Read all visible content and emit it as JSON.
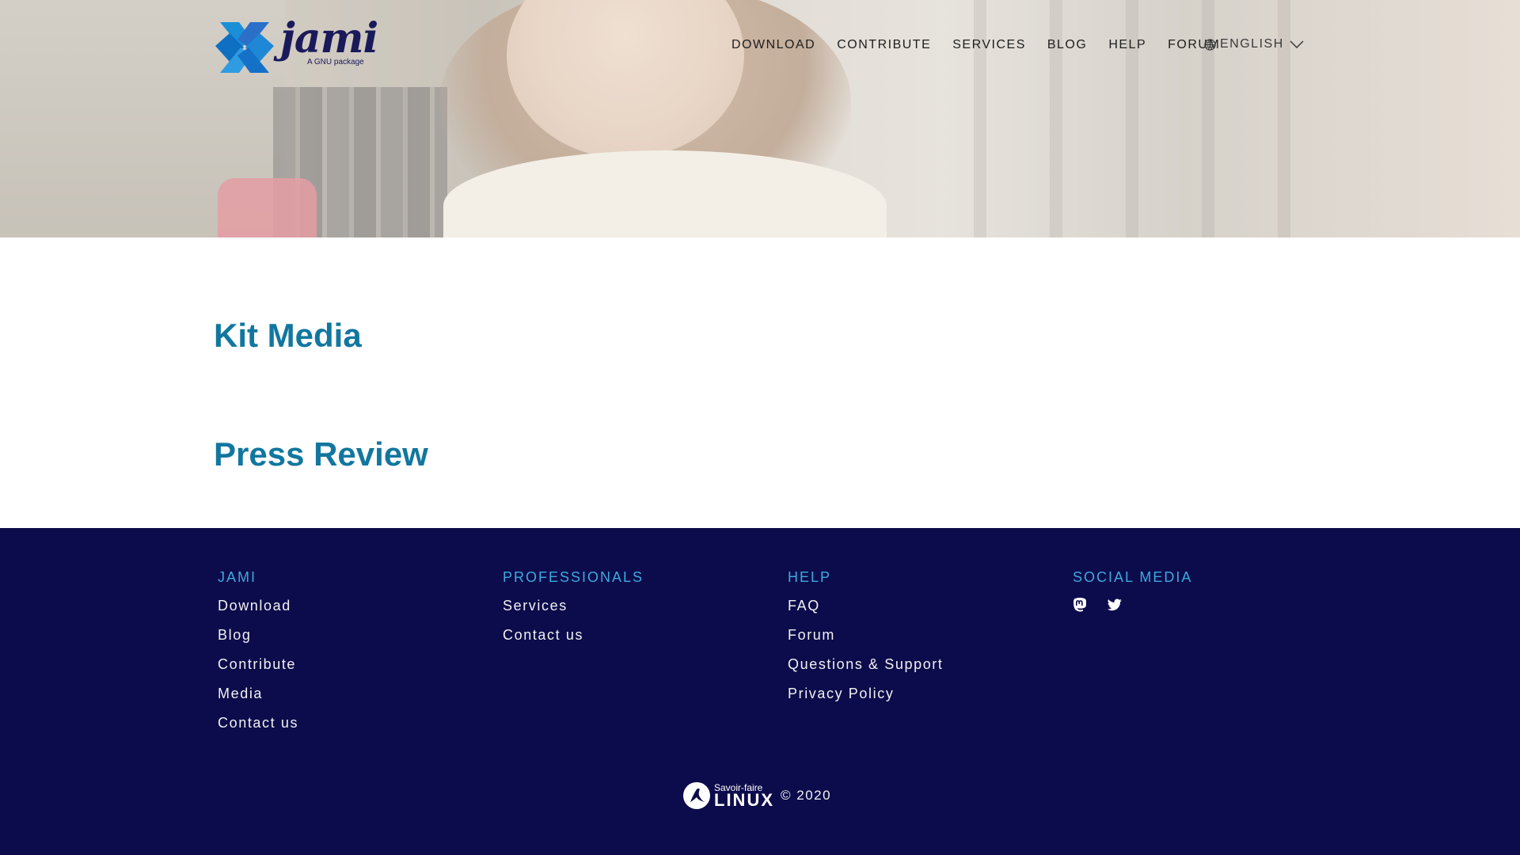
{
  "header": {
    "logo": {
      "word": "jami",
      "tagline": "A GNU package"
    },
    "nav": [
      "DOWNLOAD",
      "CONTRIBUTE",
      "SERVICES",
      "BLOG",
      "HELP",
      "FORUM"
    ],
    "language": "ENGLISH"
  },
  "main": {
    "kit_media_title": "Kit Media",
    "press_review_title": "Press Review"
  },
  "footer": {
    "columns": [
      {
        "title": "JAMI",
        "links": [
          "Download",
          "Blog",
          "Contribute",
          "Media",
          "Contact us"
        ]
      },
      {
        "title": "PROFESSIONALS",
        "links": [
          "Services",
          "Contact us"
        ]
      },
      {
        "title": "HELP",
        "links": [
          "FAQ",
          "Forum",
          "Questions & Support",
          "Privacy Policy"
        ]
      },
      {
        "title": "SOCIAL MEDIA",
        "links": []
      }
    ],
    "social_icons": [
      "mastodon-icon",
      "twitter-icon"
    ],
    "company_logo": {
      "line1": "Savoir-faire",
      "line2": "LINUX"
    },
    "copyright": "© 2020"
  },
  "colors": {
    "accent": "#12779f",
    "footer_bg": "#0c0c4c",
    "footer_heading": "#3fa9dc",
    "logo_blue": "#1a8fd8",
    "logo_navy": "#1a1a5a"
  }
}
